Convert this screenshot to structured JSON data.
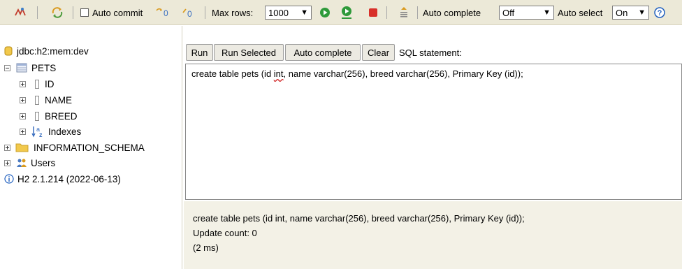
{
  "toolbar": {
    "auto_commit_label": "Auto commit",
    "max_rows_label": "Max rows:",
    "max_rows_value": "1000",
    "auto_complete_label": "Auto complete",
    "auto_complete_value": "Off",
    "auto_select_label": "Auto select",
    "auto_select_value": "On",
    "icons": [
      "disconnect-icon",
      "refresh-icon",
      "autocommit-checkbox",
      "rollback-icon",
      "commit-icon",
      "run-icon",
      "run-selected-icon",
      "stop-icon",
      "history-icon",
      "help-icon"
    ]
  },
  "tree": {
    "connection": "jdbc:h2:mem:dev",
    "table": "PETS",
    "columns": [
      "ID",
      "NAME",
      "BREED"
    ],
    "indexes": "Indexes",
    "schema": "INFORMATION_SCHEMA",
    "users": "Users",
    "version": "H2 2.1.214 (2022-06-13)"
  },
  "query": {
    "run": "Run",
    "run_selected": "Run Selected",
    "auto_complete": "Auto complete",
    "clear": "Clear",
    "sql_label": "SQL statement:",
    "sql_before": "create table pets (id ",
    "sql_flagged": "int",
    "sql_after": ", name varchar(256), breed varchar(256), Primary Key (id));"
  },
  "results": {
    "statement": "create table pets (id int, name varchar(256), breed varchar(256), Primary Key (id));",
    "update_count": "Update count: 0",
    "time": "(2 ms)"
  },
  "colors": {
    "toolbar_bg": "#ece9d8",
    "results_bg": "#f3f1e6",
    "run_green": "#2e9a3a",
    "stop_red": "#d8302a",
    "help_blue": "#1f5fbf",
    "folder_yellow": "#f2c94c"
  }
}
